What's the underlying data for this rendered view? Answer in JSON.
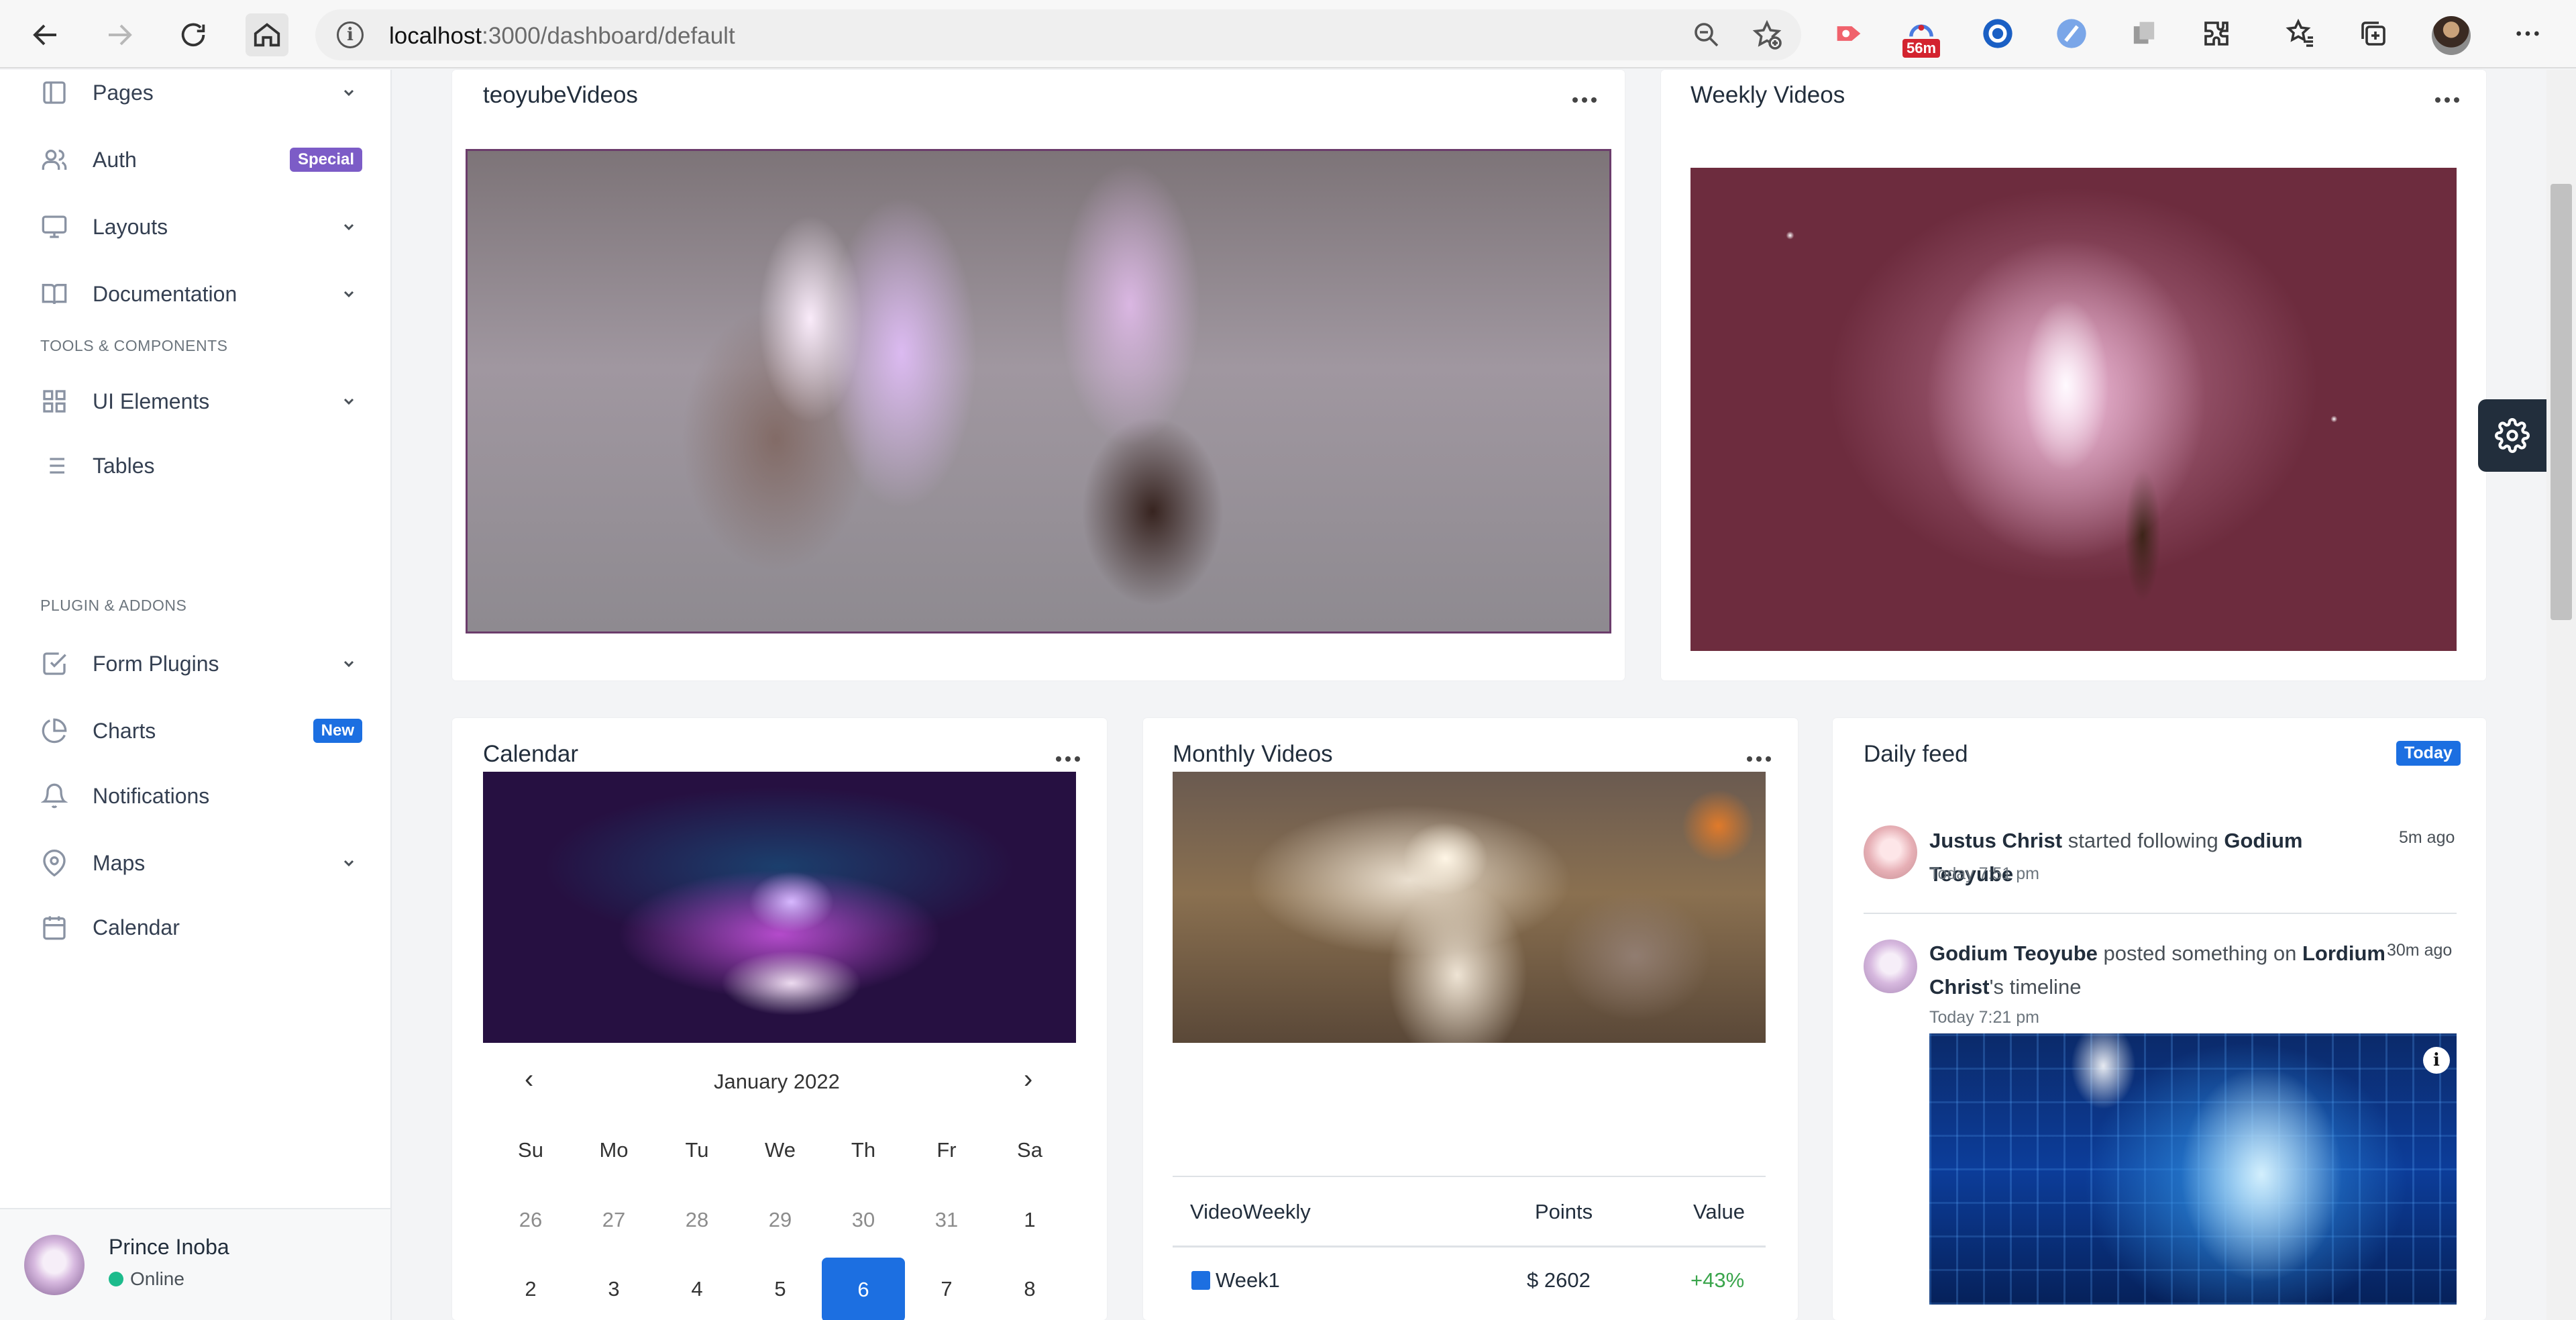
{
  "browser": {
    "url_host": "localhost",
    "url_path": ":3000/dashboard/default",
    "badge_text": "56m"
  },
  "sidebar": {
    "items": [
      {
        "label": "Pages"
      },
      {
        "label": "Auth",
        "badge": "Special",
        "badge_color": "#7c5cc7"
      },
      {
        "label": "Layouts"
      },
      {
        "label": "Documentation"
      },
      {
        "label": "UI Elements"
      },
      {
        "label": "Tables"
      },
      {
        "label": "Form Plugins"
      },
      {
        "label": "Charts",
        "badge": "New",
        "badge_color": "#1c6fe1"
      },
      {
        "label": "Notifications"
      },
      {
        "label": "Maps"
      },
      {
        "label": "Calendar"
      }
    ],
    "headers": {
      "tools": "TOOLS & COMPONENTS",
      "plugins": "PLUGIN & ADDONS"
    },
    "user": {
      "name": "Prince Inoba",
      "status": "Online"
    }
  },
  "cards": {
    "teoyube": {
      "title": "teoyubeVideos"
    },
    "weekly": {
      "title": "Weekly Videos"
    },
    "calendar": {
      "title": "Calendar"
    },
    "monthly": {
      "title": "Monthly Videos"
    },
    "feed": {
      "title": "Daily feed",
      "badge": "Today"
    }
  },
  "calendar": {
    "month": "January 2022",
    "prev": "‹",
    "next": "›",
    "days_of_week": [
      "Su",
      "Mo",
      "Tu",
      "We",
      "Th",
      "Fr",
      "Sa"
    ],
    "row1": [
      "26",
      "27",
      "28",
      "29",
      "30",
      "31",
      "1"
    ],
    "row2": [
      "2",
      "3",
      "4",
      "5",
      "6",
      "7",
      "8"
    ],
    "selected": "6"
  },
  "table": {
    "headers": [
      "VideoWeekly",
      "Points",
      "Value"
    ],
    "rows": [
      {
        "name": "Week1",
        "points": "$ 2602",
        "value": "+43%",
        "color": "#1c6fe1"
      }
    ]
  },
  "feed": {
    "items": [
      {
        "actor": "Justus Christ",
        "action": "started following",
        "target": "Godium Teoyube",
        "ago": "5m ago",
        "time": "Today 7:51 pm"
      },
      {
        "actor": "Godium Teoyube",
        "action": "posted something on",
        "target": "Lordium Christ",
        "suffix": "'s timeline",
        "ago": "30m ago",
        "time": "Today 7:21 pm"
      }
    ]
  },
  "colors": {
    "primary": "#1c6fe1",
    "special": "#7c5cc7",
    "success": "#1cbb8c",
    "positive": "#3aa54c",
    "dark": "#222e3c"
  }
}
